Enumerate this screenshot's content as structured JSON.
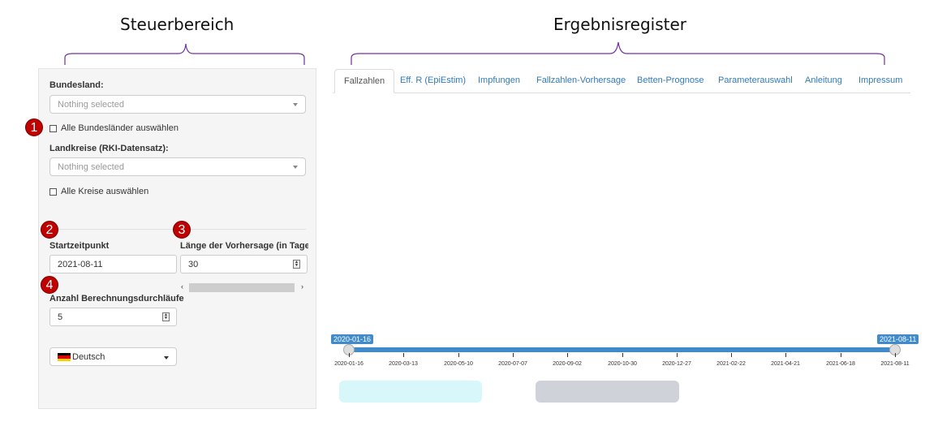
{
  "annotations": {
    "left_heading": "Steuerbereich",
    "right_heading": "Ergebnisregister",
    "markers": [
      "1",
      "2",
      "3",
      "4"
    ]
  },
  "sidebar": {
    "bundesland": {
      "label": "Bundesland:",
      "placeholder": "Nothing selected"
    },
    "all_states": {
      "label": "Alle Bundesländer auswählen",
      "checked": false
    },
    "landkreise": {
      "label": "Landkreise (RKI-Datensatz):",
      "placeholder": "Nothing selected"
    },
    "all_districts": {
      "label": "Alle Kreise auswählen",
      "checked": false
    },
    "start": {
      "label": "Startzeitpunkt",
      "value": "2021-08-11"
    },
    "forecast": {
      "label": "Länge der Vorhersage (in Tagen",
      "value": "30"
    },
    "runs": {
      "label": "Anzahl Berechnungsdurchläufe",
      "value": "5"
    },
    "language": {
      "value": "Deutsch",
      "flag": [
        "#000000",
        "#dd0000",
        "#ffce00"
      ]
    },
    "scroll_left": "‹",
    "scroll_right": "›"
  },
  "tabs": [
    {
      "label": "Fallzahlen",
      "active": true
    },
    {
      "label": "Eff. R (EpiEstim)",
      "active": false
    },
    {
      "label": "Impfungen",
      "active": false
    },
    {
      "label": "Fallzahlen-Vorhersage",
      "active": false
    },
    {
      "label": "Betten-Prognose",
      "active": false
    },
    {
      "label": "Parameterauswahl",
      "active": false
    },
    {
      "label": "Anleitung",
      "active": false
    },
    {
      "label": "Impressum",
      "active": false
    }
  ],
  "slider": {
    "min_label": "2020-01-16",
    "max_label": "2021-08-11",
    "ticks": [
      "2020-01-16",
      "2020-03-13",
      "2020-05-10",
      "2020-07-07",
      "2020-09-02",
      "2020-10-30",
      "2020-12-27",
      "2021-02-22",
      "2021-04-21",
      "2021-06-18",
      "2021-08-11"
    ]
  },
  "colors": {
    "accent": "#428bca",
    "marker": "#c00000",
    "bracket": "#7030a0",
    "button_light": "#d7f7fb",
    "button_gray": "#cfd2d9"
  }
}
